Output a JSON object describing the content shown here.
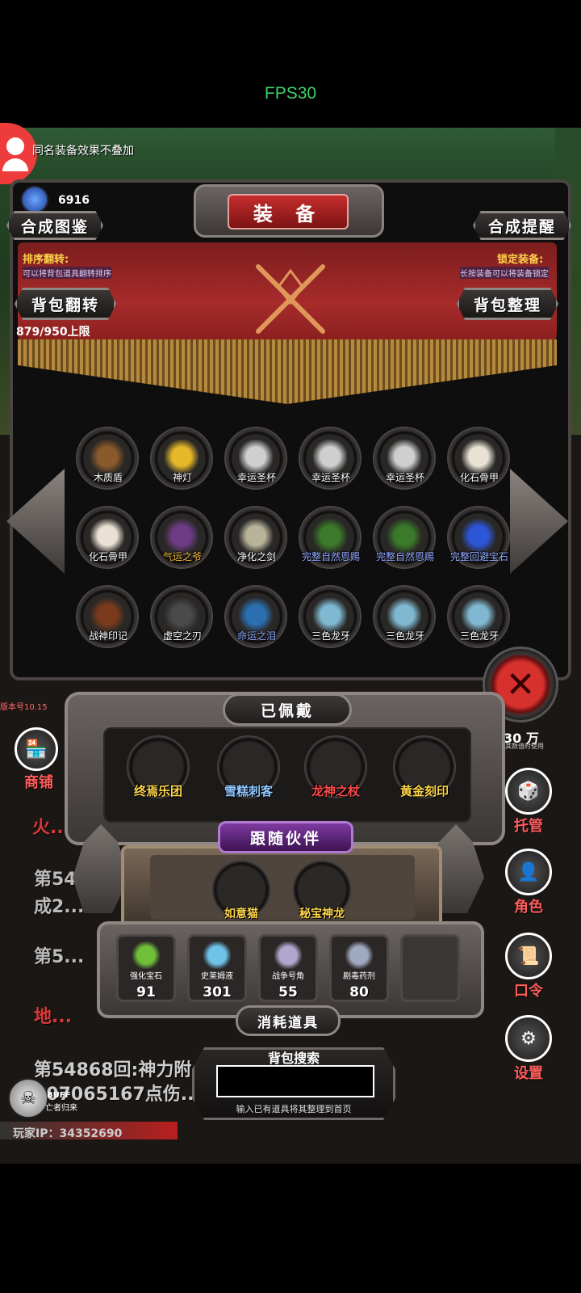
{
  "fps": "FPS30",
  "notice": "同名装备效果不叠加",
  "currency": "6916",
  "title": "装 备",
  "buttons": {
    "synth_codex": "合成图鉴",
    "synth_remind": "合成提醒",
    "flip": "背包翻转",
    "sort": "背包整理"
  },
  "sort_flip": {
    "label": "排序翻转:",
    "desc": "可以将背包道具翻转排序"
  },
  "lock_equip": {
    "label": "锁定装备:",
    "desc": "长按装备可以将装备锁定"
  },
  "capacity": "879/950上限",
  "items": [
    {
      "name": "木质盾",
      "color": "white",
      "icon": "wooden-shield-icon",
      "tint": "#8a5a2b"
    },
    {
      "name": "神灯",
      "color": "white",
      "icon": "magic-lamp-icon",
      "tint": "#e5b82a"
    },
    {
      "name": "幸运圣杯",
      "color": "white",
      "icon": "grail-icon",
      "tint": "#cfcfcf"
    },
    {
      "name": "幸运圣杯",
      "color": "white",
      "icon": "grail-icon",
      "tint": "#cfcfcf"
    },
    {
      "name": "幸运圣杯",
      "color": "white",
      "icon": "grail-icon",
      "tint": "#cfcfcf"
    },
    {
      "name": "化石骨甲",
      "color": "white",
      "icon": "bone-armor-icon",
      "tint": "#e8e1d4"
    },
    {
      "name": "化石骨甲",
      "color": "white",
      "icon": "bone-armor-icon",
      "tint": "#e8e1d4"
    },
    {
      "name": "气运之爷",
      "color": "gold",
      "icon": "fortune-orb-icon",
      "tint": "#6e3c86"
    },
    {
      "name": "净化之剑",
      "color": "white",
      "icon": "sword-icon",
      "tint": "#b9b39a"
    },
    {
      "name": "完整自然恩赐",
      "color": "blue",
      "icon": "nature-gift-icon",
      "tint": "#3a7a2a"
    },
    {
      "name": "完整自然恩赐",
      "color": "blue",
      "icon": "nature-gift-icon",
      "tint": "#3a7a2a"
    },
    {
      "name": "完整回避宝石",
      "color": "blue",
      "icon": "gem-icon",
      "tint": "#2c56d6"
    },
    {
      "name": "战神印记",
      "color": "white",
      "icon": "war-seal-icon",
      "tint": "#7a3b1c"
    },
    {
      "name": "虚空之刃",
      "color": "white",
      "icon": "void-blade-icon",
      "tint": "#4a4a4a"
    },
    {
      "name": "命运之泪",
      "color": "blue",
      "icon": "fate-tear-icon",
      "tint": "#2b6fb0"
    },
    {
      "name": "三色龙牙",
      "color": "white",
      "icon": "dragon-fang-icon",
      "tint": "#7fb8d0"
    },
    {
      "name": "三色龙牙",
      "color": "white",
      "icon": "dragon-fang-icon",
      "tint": "#7fb8d0"
    },
    {
      "name": "三色龙牙",
      "color": "white",
      "icon": "dragon-fang-icon",
      "tint": "#7fb8d0"
    }
  ],
  "version": "版本号10.15",
  "shop_label": "商铺",
  "right_nav": {
    "silver_value": "30 万",
    "silver_sub": "其数值时使用",
    "manage": "托管",
    "role": "角色",
    "code": "口令",
    "settings": "设置"
  },
  "logs": [
    "火...",
    "第54...",
    "成2...",
    "第5...",
    "地...",
    "第54868回:神力附...",
    "507065167点伤..."
  ],
  "equipped": {
    "title": "已佩戴",
    "items": [
      {
        "name": "终焉乐团",
        "color": "#ffd54a",
        "icon": "lute-icon"
      },
      {
        "name": "雪糕刺客",
        "color": "#8fc7ff",
        "icon": "dagger-icon"
      },
      {
        "name": "龙神之杖",
        "color": "#ff4b4b",
        "icon": "dragon-staff-icon"
      },
      {
        "name": "黄金刻印",
        "color": "#ffd54a",
        "icon": "golden-seal-icon"
      }
    ]
  },
  "companion": {
    "title": "跟随伙伴",
    "pets": [
      {
        "name": "如意猫",
        "color": "#ffd54a",
        "icon": "nyan-cat-icon"
      },
      {
        "name": "秘宝神龙",
        "color": "#ffd54a",
        "icon": "golden-dragon-icon"
      }
    ]
  },
  "consumables": {
    "title": "消耗道具",
    "items": [
      {
        "name": "强化宝石",
        "count": "91",
        "icon": "enhance-gem-icon",
        "tint": "#6fbf3a"
      },
      {
        "name": "史莱姆液",
        "count": "301",
        "icon": "slime-potion-icon",
        "tint": "#6fc3e8"
      },
      {
        "name": "战争号角",
        "count": "55",
        "icon": "war-horn-icon",
        "tint": "#b2a6cf"
      },
      {
        "name": "剧毒药剂",
        "count": "80",
        "icon": "poison-flask-icon",
        "tint": "#9fa9bf"
      }
    ]
  },
  "search": {
    "title": "背包搜索",
    "hint": "输入已有道具将其整理到首页",
    "value": ""
  },
  "buff": {
    "label": "BUFF",
    "sub": "亡者归来"
  },
  "player_ip": "玩家IP：34352690"
}
